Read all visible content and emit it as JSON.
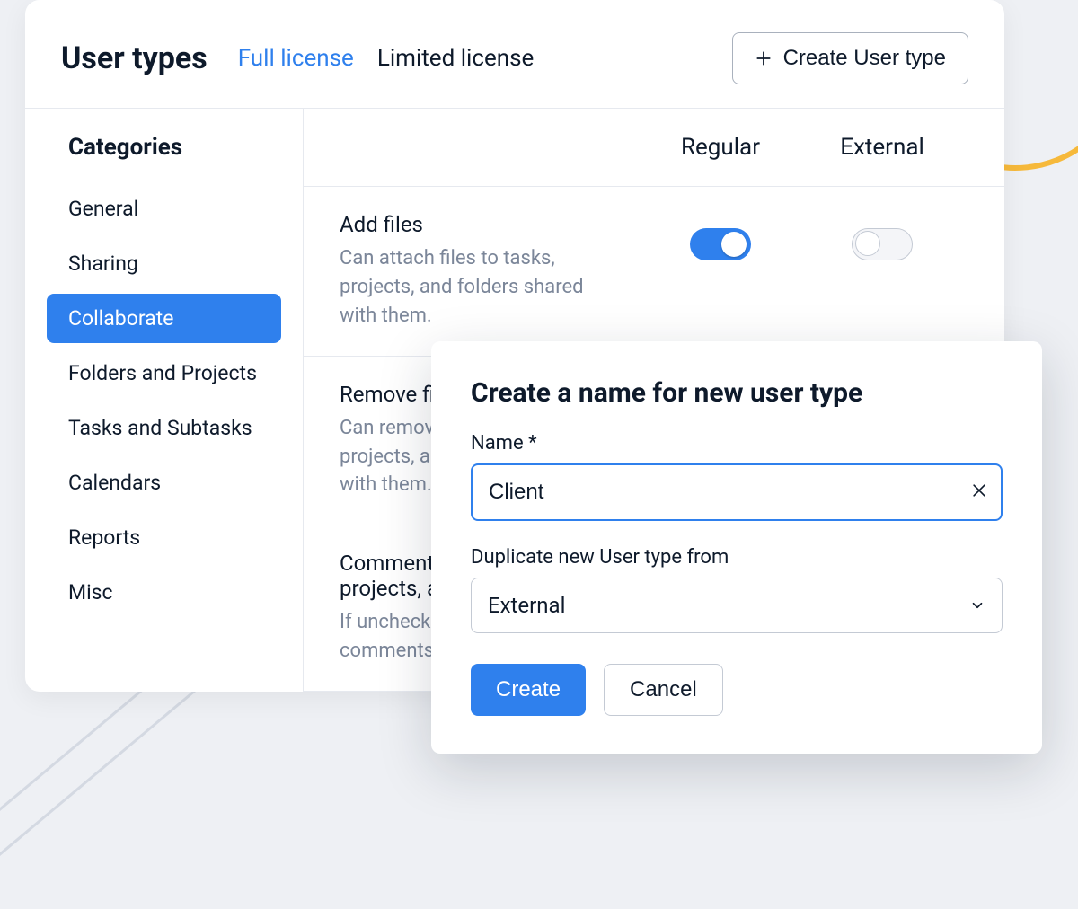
{
  "header": {
    "title": "User types",
    "tabs": {
      "full": "Full license",
      "limited": "Limited license"
    },
    "create_btn": "Create User type"
  },
  "sidebar": {
    "title": "Categories",
    "items": {
      "general": "General",
      "sharing": "Sharing",
      "collaborate": "Collaborate",
      "folders": "Folders and Projects",
      "tasks": "Tasks and Subtasks",
      "calendars": "Calendars",
      "reports": "Reports",
      "misc": "Misc"
    },
    "active": "collaborate"
  },
  "columns": {
    "regular": "Regular",
    "external": "External"
  },
  "permissions": [
    {
      "id": "add-files",
      "title": "Add files",
      "desc": "Can attach files to tasks, projects, and folders shared with them.",
      "regular": true,
      "external": false
    },
    {
      "id": "remove-files",
      "title": "Remove files",
      "desc": "Can remove files from tasks, projects, and folders shared with them."
    },
    {
      "id": "comments",
      "title": "Comments on tasks, projects, and folders",
      "desc": "If unchecked, user will still view comments."
    }
  ],
  "modal": {
    "title": "Create a name for new user type",
    "name_label": "Name *",
    "name_value": "Client",
    "duplicate_label": "Duplicate new User type from",
    "duplicate_value": "External",
    "create_btn": "Create",
    "cancel_btn": "Cancel"
  },
  "colors": {
    "primary": "#2f80ed",
    "text": "#0e1a2b",
    "muted": "#7b8699"
  }
}
